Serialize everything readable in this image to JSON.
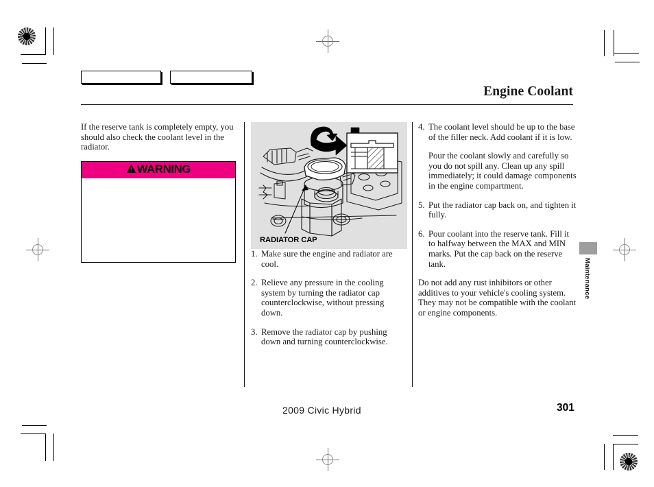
{
  "document": {
    "title": "Engine Coolant",
    "footer_model": "2009  Civic  Hybrid",
    "page_number": "301",
    "side_tab_label": "Maintenance"
  },
  "colors": {
    "warning_pink": "#ee0080",
    "illustration_background": "#e0e0e0",
    "side_tab_marker": "#9e9e9e",
    "rule": "#1a1a1a"
  },
  "left_column": {
    "intro_paragraph": "If the reserve tank is completely empty, you should also check the coolant level in the radiator.",
    "warning": {
      "heading": "WARNING",
      "symbol": "warning-triangle-icon",
      "body": ""
    }
  },
  "middle_column": {
    "illustration": {
      "caption": "RADIATOR CAP",
      "alt": "radiator-cap-line-art"
    },
    "steps": [
      {
        "num": "1.",
        "text": "Make sure the engine and radiator are cool."
      },
      {
        "num": "2.",
        "text": "Relieve any pressure in the cooling system by turning the radiator cap counterclockwise, without pressing down."
      },
      {
        "num": "3.",
        "text": "Remove the radiator cap by pushing down and turning counterclockwise."
      }
    ]
  },
  "right_column": {
    "steps": [
      {
        "num": "4.",
        "text": "The coolant level should be up to the base of the filler neck. Add coolant if it is low."
      },
      {
        "num": "5.",
        "text": "Put the radiator cap back on, and tighten it fully."
      },
      {
        "num": "6.",
        "text": "Pour coolant into the reserve tank. Fill it to halfway between the MAX and MIN marks. Put the cap back on the reserve tank."
      }
    ],
    "note_after_step4": "Pour the coolant slowly and carefully so you do not spill any. Clean up any spill immediately; it could damage components in the engine compartment.",
    "closing_note": "Do not add any rust inhibitors or other additives to your vehicle's cooling system. They may not be compatible with the coolant or engine components."
  },
  "tab_boxes": [
    {
      "label": ""
    },
    {
      "label": ""
    }
  ]
}
